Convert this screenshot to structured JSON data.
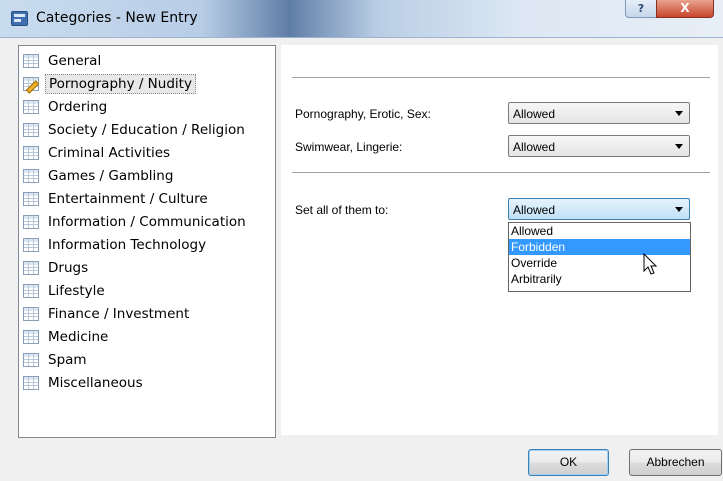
{
  "window": {
    "title": "Categories - New Entry",
    "help_label": "?",
    "close_label": "X"
  },
  "categories": [
    {
      "label": "General",
      "icon": "grid-icon",
      "selected": false
    },
    {
      "label": "Pornography / Nudity",
      "icon": "edit-grid-icon",
      "selected": true
    },
    {
      "label": "Ordering",
      "icon": "grid-icon",
      "selected": false
    },
    {
      "label": "Society / Education / Religion",
      "icon": "grid-icon",
      "selected": false
    },
    {
      "label": "Criminal Activities",
      "icon": "grid-icon",
      "selected": false
    },
    {
      "label": "Games / Gambling",
      "icon": "grid-icon",
      "selected": false
    },
    {
      "label": "Entertainment / Culture",
      "icon": "grid-icon",
      "selected": false
    },
    {
      "label": "Information / Communication",
      "icon": "grid-icon",
      "selected": false
    },
    {
      "label": "Information Technology",
      "icon": "grid-icon",
      "selected": false
    },
    {
      "label": "Drugs",
      "icon": "grid-icon",
      "selected": false
    },
    {
      "label": "Lifestyle",
      "icon": "grid-icon",
      "selected": false
    },
    {
      "label": "Finance / Investment",
      "icon": "grid-icon",
      "selected": false
    },
    {
      "label": "Medicine",
      "icon": "grid-icon",
      "selected": false
    },
    {
      "label": "Spam",
      "icon": "grid-icon",
      "selected": false
    },
    {
      "label": "Miscellaneous",
      "icon": "grid-icon",
      "selected": false
    }
  ],
  "settings": {
    "fields": [
      {
        "label": "Pornography, Erotic, Sex:",
        "value": "Allowed"
      },
      {
        "label": "Swimwear, Lingerie:",
        "value": "Allowed"
      }
    ],
    "set_all": {
      "label": "Set all of them to:",
      "value": "Allowed"
    },
    "dropdown_options": [
      "Allowed",
      "Forbidden",
      "Override",
      "Arbitrarily"
    ],
    "highlighted_option": "Forbidden"
  },
  "buttons": {
    "ok": "OK",
    "cancel": "Abbrechen"
  },
  "colors": {
    "highlight": "#3399ff",
    "close_button": "#c8452d"
  }
}
